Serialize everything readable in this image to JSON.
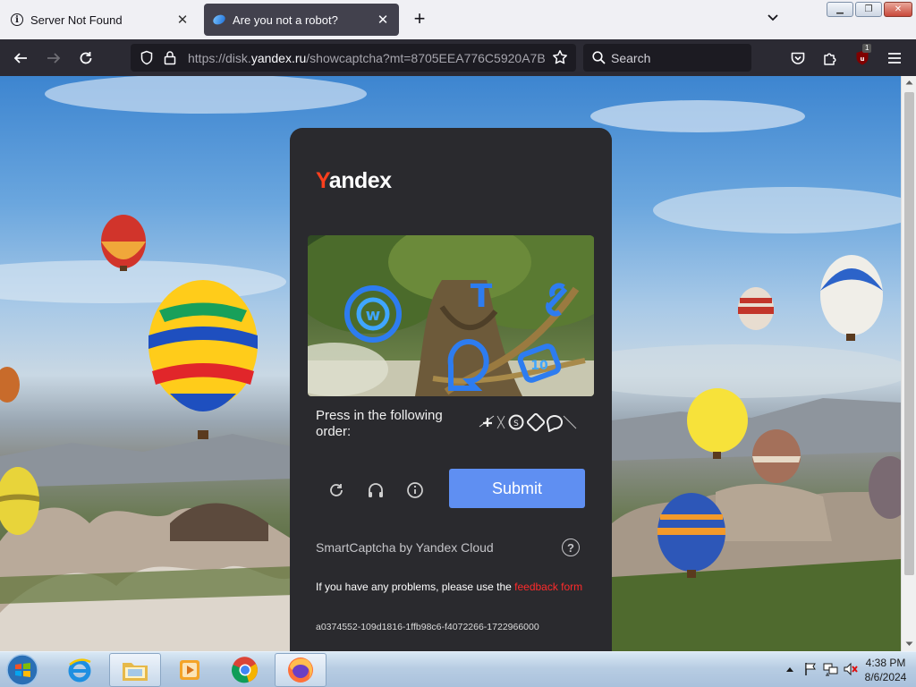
{
  "browser": {
    "tabs": [
      {
        "label": "Server Not Found",
        "icon": "info-icon",
        "active": false
      },
      {
        "label": "Are you not a robot?",
        "icon": "yandex-disk-icon",
        "active": true
      }
    ],
    "url": {
      "prefix": "https://disk.",
      "host": "yandex.ru",
      "path": "/showcaptcha?mt=8705EEA776C5920A7B"
    },
    "search_placeholder": "Search",
    "extension_badge": "1"
  },
  "captcha": {
    "logo": {
      "first_letter": "Y",
      "rest": "andex"
    },
    "instruction": "Press in the following order:",
    "submit_label": "Submit",
    "footer_brand": "SmartCaptcha by Yandex Cloud",
    "help_glyph": "?",
    "problem_text": "If you have any problems, please use the ",
    "problem_link": "feedback form",
    "request_id": "a0374552-109d1816-1ffb98c6-f4072266-1722966000",
    "colors": {
      "panel": "#2a2a2e",
      "submit": "#5f8ff2",
      "logo_y": "#fc3f1d",
      "link": "#ff2b2b"
    }
  },
  "taskbar": {
    "apps": [
      "internet-explorer",
      "windows-explorer",
      "media-player",
      "chrome",
      "firefox"
    ],
    "clock": {
      "time": "4:38 PM",
      "date": "8/6/2024"
    }
  }
}
